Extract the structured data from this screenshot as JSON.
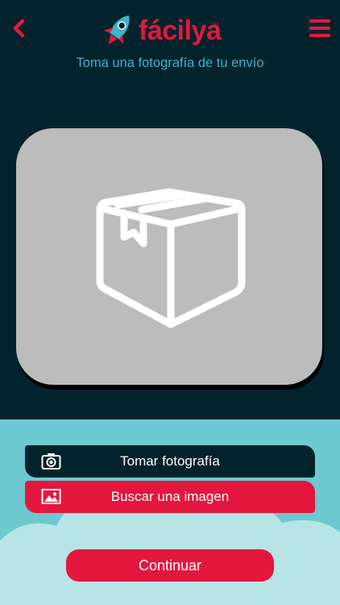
{
  "header": {
    "logo_text": "fácilya",
    "logo_mark": "SM",
    "back_icon": "chevron-left-icon",
    "menu_icon": "hamburger-menu-icon",
    "subtitle": "Toma una fotografía de tu envío"
  },
  "photo_placeholder": {
    "icon": "package-box-icon"
  },
  "actions": {
    "take_photo_label": "Tomar fotografía",
    "take_photo_icon": "camera-icon",
    "search_image_label": "Buscar una imagen",
    "search_image_icon": "image-icon",
    "continue_label": "Continuar"
  },
  "colors": {
    "brand_red": "#e3173e",
    "dark_teal": "#03232c",
    "accent_cyan": "#3ab5c9",
    "sky": "#6cc9d0",
    "cloud": "#b8e4e6",
    "placeholder_gray": "#bcbcbc"
  }
}
